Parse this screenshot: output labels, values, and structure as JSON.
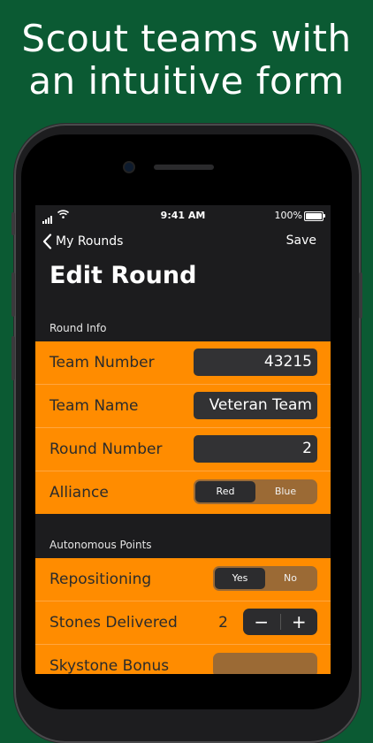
{
  "headline": {
    "line1": "Scout teams with",
    "line2": "an intuitive form"
  },
  "status_bar": {
    "time": "9:41 AM",
    "battery": "100%"
  },
  "nav": {
    "back_label": "My Rounds",
    "save_label": "Save",
    "title": "Edit Round"
  },
  "round_info": {
    "header": "Round Info",
    "team_number": {
      "label": "Team Number",
      "value": "43215"
    },
    "team_name": {
      "label": "Team Name",
      "value": "Veteran Team"
    },
    "round_number": {
      "label": "Round Number",
      "value": "2"
    },
    "alliance": {
      "label": "Alliance",
      "options": [
        "Red",
        "Blue"
      ],
      "selected": "Red"
    }
  },
  "autonomous": {
    "header": "Autonomous Points",
    "repositioning": {
      "label": "Repositioning",
      "options": [
        "Yes",
        "No"
      ],
      "selected": "Yes"
    },
    "stones_delivered": {
      "label": "Stones Delivered",
      "value": "2",
      "minus": "−",
      "plus": "+"
    },
    "skystone": {
      "label": "Skystone Bonus"
    }
  },
  "colors": {
    "background": "#0b5a33",
    "accent": "#ff8c00",
    "screen": "#1c1c1e"
  }
}
